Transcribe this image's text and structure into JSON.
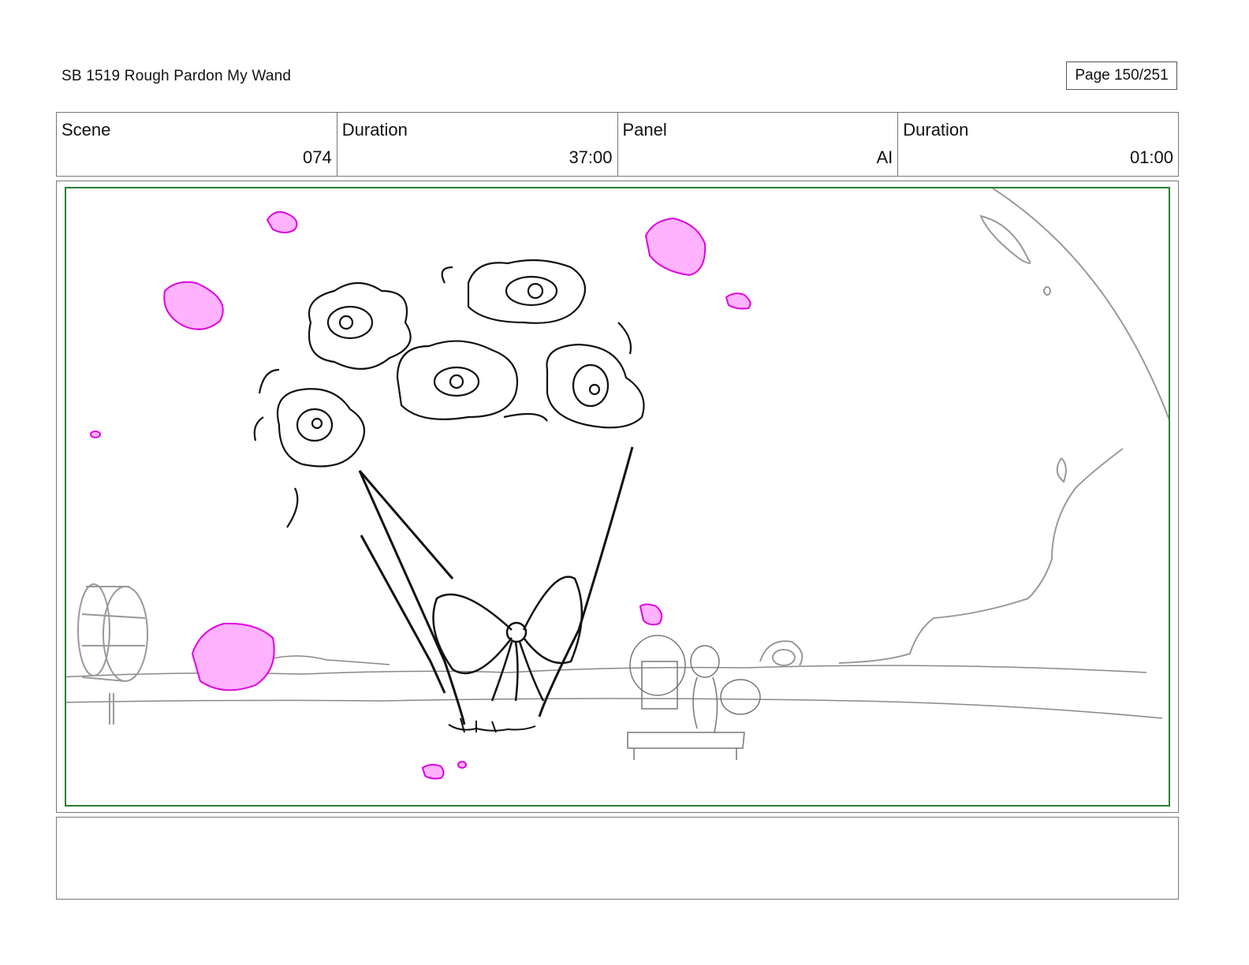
{
  "header": {
    "title": "SB 1519 Rough  Pardon My Wand",
    "page": "Page 150/251"
  },
  "info": {
    "scene_label": "Scene",
    "scene_value": "074",
    "duration_label": "Duration",
    "duration_value": "37:00",
    "panel_label": "Panel",
    "panel_value": "AI",
    "panel_duration_label": "Duration",
    "panel_duration_value": "01:00"
  },
  "colors": {
    "panel_border": "#2e7d32",
    "petal": "#ff66ff"
  },
  "panel": {
    "image": "storyboard-drawing-bouquet"
  },
  "notes": {
    "text": ""
  }
}
